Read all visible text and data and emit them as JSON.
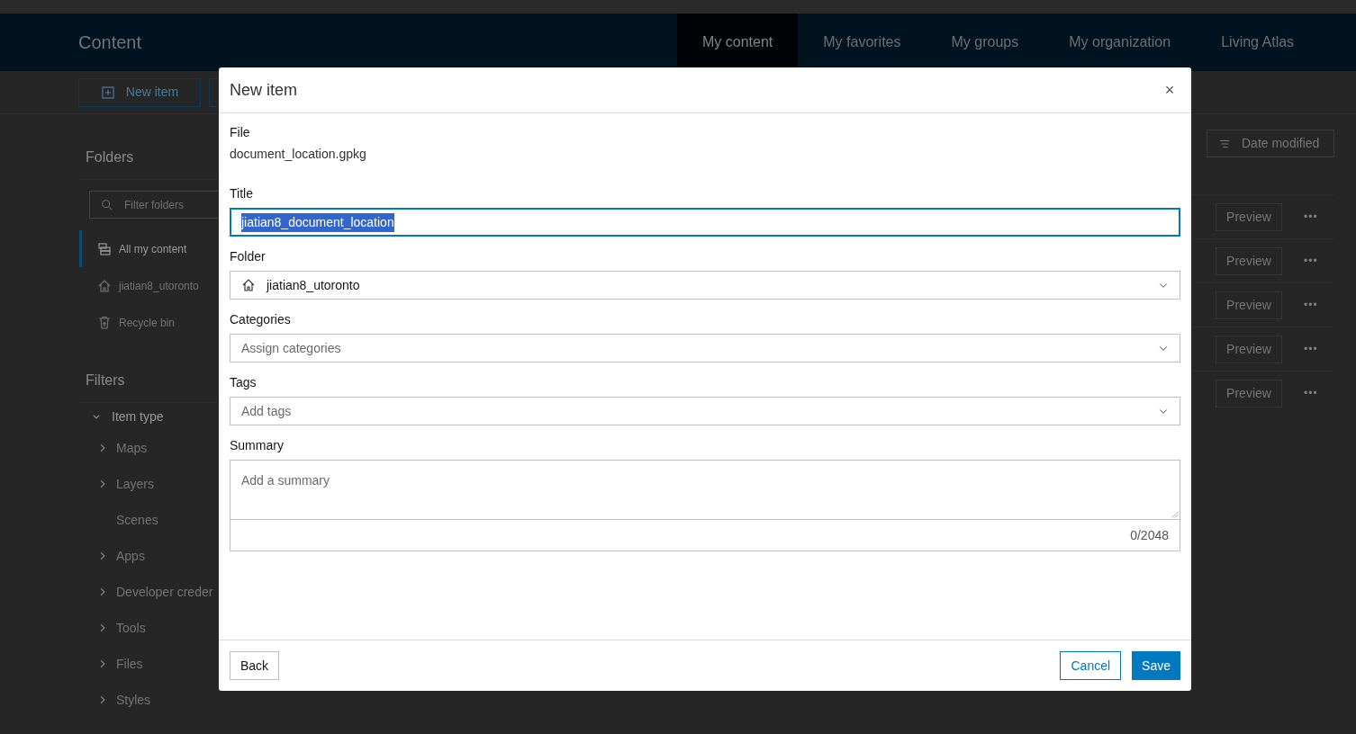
{
  "header": {
    "title": "Content",
    "tabs": [
      {
        "label": "My content",
        "selected": true
      },
      {
        "label": "My favorites",
        "selected": false
      },
      {
        "label": "My groups",
        "selected": false
      },
      {
        "label": "My organization",
        "selected": false
      },
      {
        "label": "Living Atlas",
        "selected": false
      }
    ]
  },
  "toolbar": {
    "new_item_button": "New item"
  },
  "sidebar": {
    "folders_heading": "Folders",
    "filter_placeholder": "Filter folders",
    "folders": [
      {
        "label": "All my content",
        "selected": true
      },
      {
        "label": "jiatian8_utoronto",
        "selected": false
      },
      {
        "label": "Recycle bin",
        "selected": false
      }
    ],
    "filters_heading": "Filters",
    "item_type": {
      "label": "Item type",
      "expanded": true,
      "children": [
        {
          "label": "Maps",
          "expandable": true
        },
        {
          "label": "Layers",
          "expandable": true
        },
        {
          "label": "Scenes",
          "expandable": false
        },
        {
          "label": "Apps",
          "expandable": true
        },
        {
          "label": "Developer creder",
          "expandable": true
        },
        {
          "label": "Tools",
          "expandable": true
        },
        {
          "label": "Files",
          "expandable": true
        },
        {
          "label": "Styles",
          "expandable": true
        }
      ]
    }
  },
  "results": {
    "sort_button": "Date modified",
    "rows": [
      {
        "preview_button": "Preview",
        "more_button": "•••"
      },
      {
        "preview_button": "Preview",
        "more_button": "•••"
      },
      {
        "preview_button": "Preview",
        "more_button": "•••"
      },
      {
        "preview_button": "Preview",
        "more_button": "•••"
      },
      {
        "preview_button": "Preview",
        "more_button": "•••"
      }
    ]
  },
  "dialog": {
    "title": "New item",
    "close": "×",
    "file": {
      "label": "File",
      "value": "document_location.gpkg"
    },
    "fields": [
      {
        "kind": "text",
        "label": "Title",
        "value": "jiatian8_document_location",
        "focused": true,
        "text_selected": true
      },
      {
        "kind": "select",
        "label": "Folder",
        "value": "jiatian8_utoronto"
      },
      {
        "kind": "select",
        "label": "Categories",
        "placeholder": "Assign categories"
      },
      {
        "kind": "select",
        "label": "Tags",
        "placeholder": "Add tags"
      },
      {
        "kind": "textarea",
        "label": "Summary",
        "placeholder": "Add a summary",
        "counter": "0/2048"
      }
    ],
    "back_button": "Back",
    "cancel_button": "Cancel",
    "save_button": "Save"
  }
}
